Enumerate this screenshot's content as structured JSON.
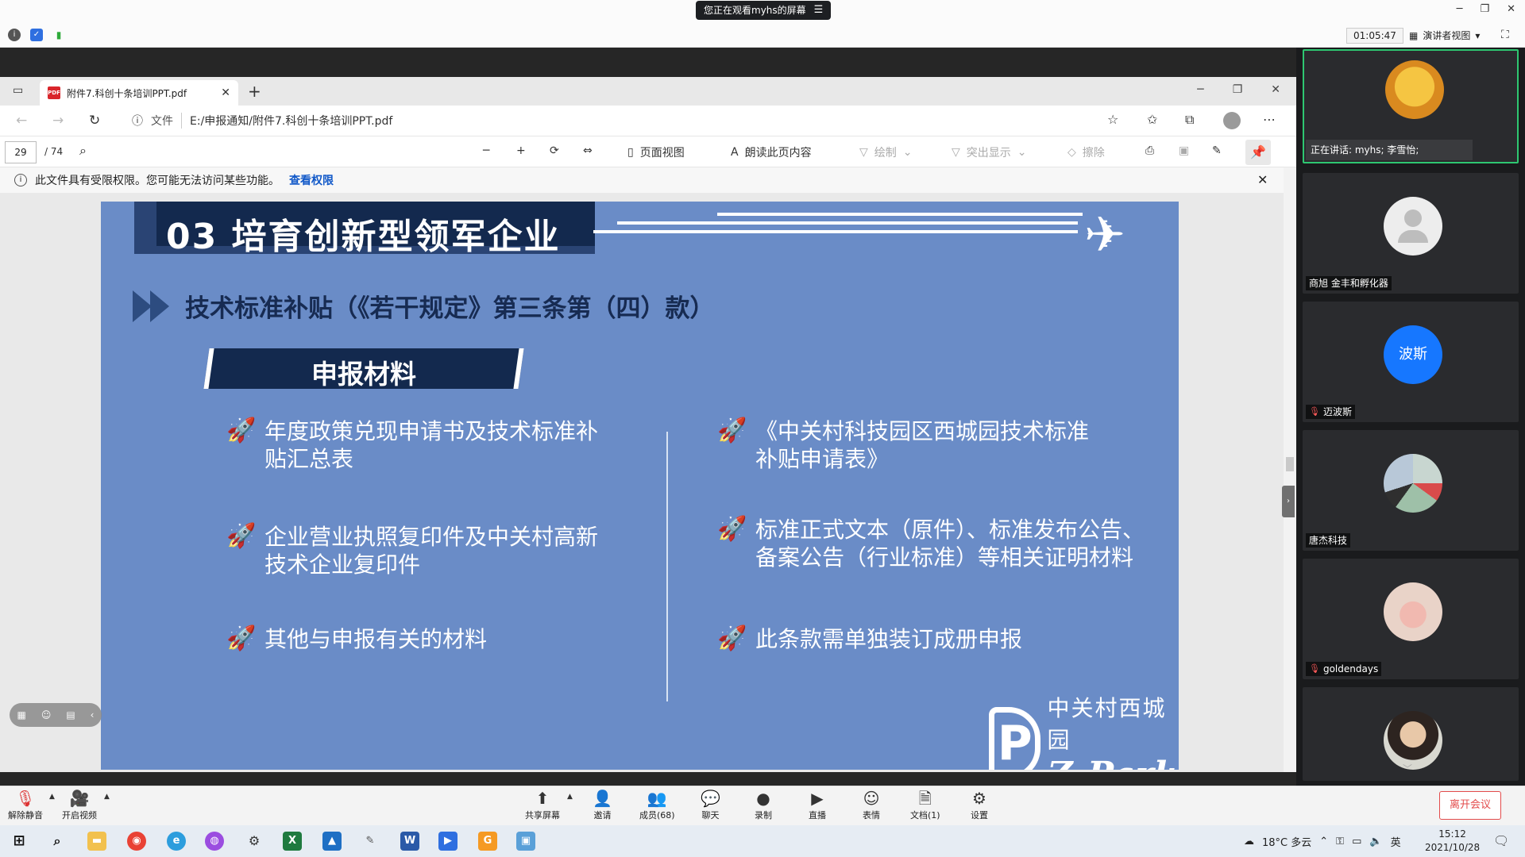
{
  "meeting": {
    "share_notice": "您正在观看myhs的屏幕",
    "timer": "01:05:47",
    "view_mode": "演讲者视图",
    "speaking_now": "正在讲话: myhs; 李雪怡;",
    "participants": [
      {
        "name": ""
      },
      {
        "name": "商旭 金丰和孵化器"
      },
      {
        "name": "迈波斯",
        "avatar_text": "波斯",
        "avatar_color": "#1677ff"
      },
      {
        "name": "唐杰科技"
      },
      {
        "name": "goldendays"
      },
      {
        "name": ""
      }
    ],
    "toolbar": {
      "unmute": "解除静音",
      "start_video": "开启视频",
      "share": "共享屏幕",
      "invite": "邀请",
      "members": "成员(68)",
      "chat": "聊天",
      "record": "录制",
      "live": "直播",
      "reactions": "表情",
      "docs": "文档(1)",
      "settings": "设置",
      "leave": "离开会议"
    }
  },
  "browser": {
    "tab_title": "附件7.科创十条培训PPT.pdf",
    "address_prefix": "文件",
    "address": "E:/申报通知/附件7.科创十条培训PPT.pdf",
    "page_current": "29",
    "page_total": "/ 74",
    "tools": {
      "page_view": "页面视图",
      "read_aloud": "朗读此页内容",
      "draw": "绘制",
      "highlight": "突出显示",
      "erase": "擦除"
    },
    "permission_msg": "此文件具有受限权限。您可能无法访问某些功能。",
    "permission_link": "查看权限"
  },
  "slide": {
    "section_title": "03 培育创新型领军企业",
    "heading": "技术标准补贴（《若干规定》第三条第（四）款）",
    "materials_label": "申报材料",
    "left_items": [
      {
        "line1": "年度政策兑现申请书及技术标准补",
        "line2": "贴汇总表"
      },
      {
        "line1": "企业营业执照复印件及中关村高新",
        "line2": "技术企业复印件"
      },
      {
        "line1": "其他与申报有关的材料",
        "line2": ""
      }
    ],
    "right_items": [
      {
        "line1": "《中关村科技园区西城园技术标准",
        "line2": "补贴申请表》"
      },
      {
        "line1": "标准正式文本（原件）、标准发布公告、",
        "line2": "备案公告（行业标准）等相关证明材料"
      },
      {
        "line1": "此条款需单独装订成册申报",
        "line2": ""
      }
    ],
    "logo_zh": "中关村西城园",
    "logo_en": "Z-Park"
  },
  "taskbar": {
    "weather": "18°C 多云",
    "ime": "英",
    "time": "15:12",
    "date": "2021/10/28"
  },
  "colors": {
    "slide_bg": "#6a8cc7",
    "title_dark": "#13294e",
    "leave_red": "#e34b4b",
    "active_green": "#2ec771"
  }
}
